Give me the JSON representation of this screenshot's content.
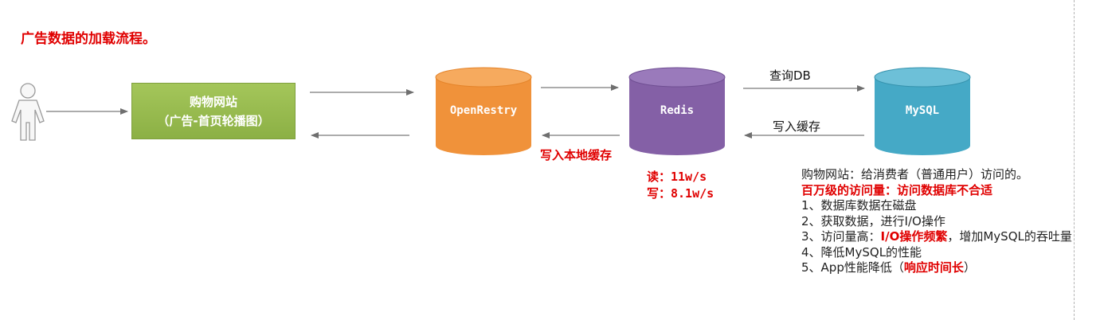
{
  "title": "广告数据的加载流程。",
  "nodes": {
    "website": {
      "line1": "购物网站",
      "line2": "（广告-首页轮播图）"
    },
    "openresty": {
      "label": "OpenRestry",
      "color": "#f0923a"
    },
    "redis": {
      "label": "Redis",
      "color": "#8460a6"
    },
    "mysql": {
      "label": "MySQL",
      "color": "#45a9c6"
    }
  },
  "edges": {
    "query_db": "查询DB",
    "write_cache": "写入缓存",
    "write_local_cache": "写入本地缓存"
  },
  "redis_stats": {
    "read": "读：11w/s",
    "write": "写：8.1w/s"
  },
  "notes": {
    "intro": "购物网站：给消费者（普通用户）访问的。",
    "headline": "百万级的访问量：访问数据库不合适",
    "item1": "1、数据库数据在磁盘",
    "item2": "2、获取数据，进行I/O操作",
    "item3_pre": "3、访问量高：",
    "item3_hl": "I/O操作频繁",
    "item3_post": "，增加MySQL的吞吐量",
    "item4": "4、降低MySQL的性能",
    "item5_pre": "5、App性能降低（",
    "item5_hl": "响应时间长",
    "item5_post": "）"
  }
}
